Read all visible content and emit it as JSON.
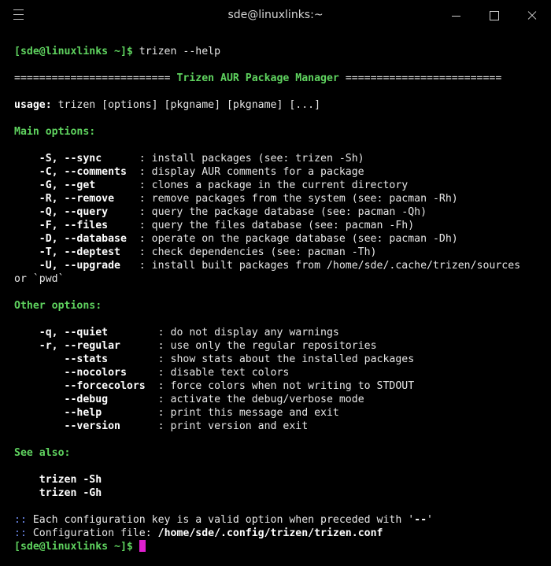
{
  "window": {
    "title": "sde@linuxlinks:~",
    "menu_icon": "hamburger-icon",
    "buttons": [
      "minimize-icon",
      "maximize-icon",
      "close-icon"
    ]
  },
  "colors": {
    "background": "#000000",
    "prompt": "#5fd35f",
    "hint": "#6f8cf0",
    "cursor": "#e020d0",
    "text": "#e6e6e6"
  },
  "terminal": {
    "prompt": "[sde@linuxlinks ~]$",
    "command": " trizen --help",
    "banner": {
      "left": "========================= ",
      "title": "Trizen AUR Package Manager",
      "right": " ========================="
    },
    "usage_label": "usage:",
    "usage_text": " trizen [options] [pkgname] [pkgname] [...]",
    "main_heading": "Main options:",
    "main_options": [
      {
        "flag": "    -S, --sync      ",
        "desc": ": install packages (see: trizen -Sh)"
      },
      {
        "flag": "    -C, --comments  ",
        "desc": ": display AUR comments for a package"
      },
      {
        "flag": "    -G, --get       ",
        "desc": ": clones a package in the current directory"
      },
      {
        "flag": "    -R, --remove    ",
        "desc": ": remove packages from the system (see: pacman -Rh)"
      },
      {
        "flag": "    -Q, --query     ",
        "desc": ": query the package database (see: pacman -Qh)"
      },
      {
        "flag": "    -F, --files     ",
        "desc": ": query the files database (see: pacman -Fh)"
      },
      {
        "flag": "    -D, --database  ",
        "desc": ": operate on the package database (see: pacman -Dh)"
      },
      {
        "flag": "    -T, --deptest   ",
        "desc": ": check dependencies (see: pacman -Th)"
      },
      {
        "flag": "    -U, --upgrade   ",
        "desc": ": install built packages from /home/sde/.cache/trizen/sources"
      }
    ],
    "upgrade_wrap": "or `pwd`",
    "other_heading": "Other options:",
    "other_options": [
      {
        "flag": "    -q, --quiet        ",
        "desc": ": do not display any warnings"
      },
      {
        "flag": "    -r, --regular      ",
        "desc": ": use only the regular repositories"
      },
      {
        "flag": "        --stats        ",
        "desc": ": show stats about the installed packages"
      },
      {
        "flag": "        --nocolors     ",
        "desc": ": disable text colors"
      },
      {
        "flag": "        --forcecolors  ",
        "desc": ": force colors when not writing to STDOUT"
      },
      {
        "flag": "        --debug        ",
        "desc": ": activate the debug/verbose mode"
      },
      {
        "flag": "        --help         ",
        "desc": ": print this message and exit"
      },
      {
        "flag": "        --version      ",
        "desc": ": print version and exit"
      }
    ],
    "see_heading": "See also:",
    "see_items": [
      "    trizen -Sh",
      "    trizen -Gh"
    ],
    "note1_marker": "::",
    "note1_text": " Each configuration key is a valid option when preceded with '",
    "note1_bold": "--",
    "note1_end": "'",
    "note2_marker": "::",
    "note2_text": " Configuration file: ",
    "note2_path": "/home/sde/.config/trizen/trizen.conf",
    "final_prompt": "[sde@linuxlinks ~]$",
    "final_space": " "
  }
}
